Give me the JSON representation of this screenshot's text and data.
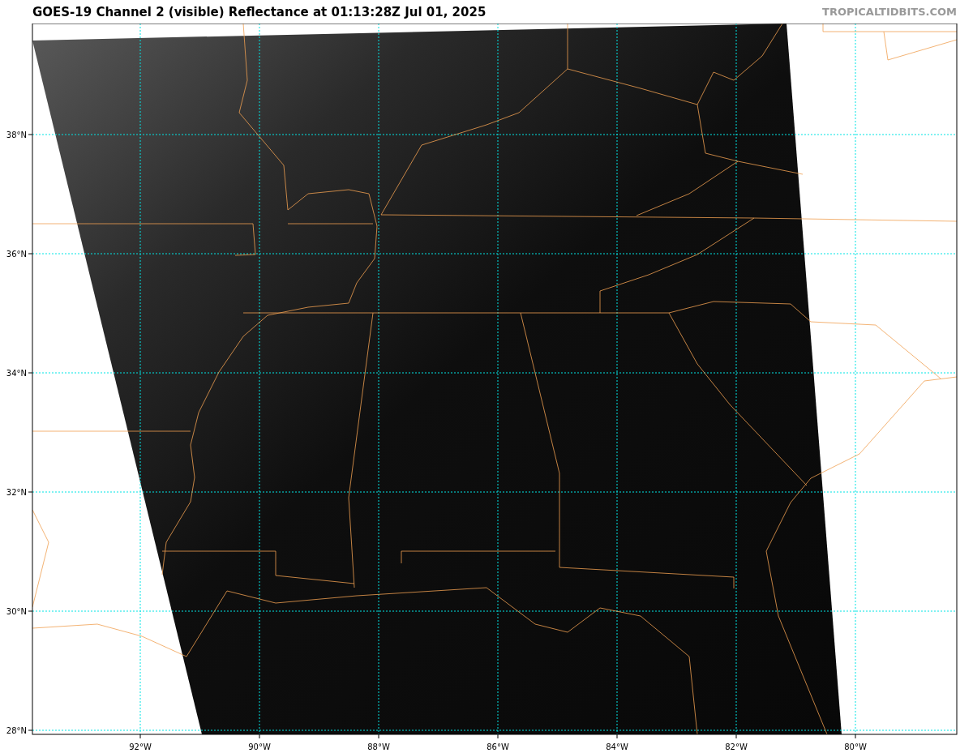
{
  "title": "GOES-19 Channel 2 (visible) Reflectance at 01:13:28Z Jul 01, 2025",
  "credit": "TROPICALTIDBITS.COM",
  "latitude_labels": [
    "38°N",
    "36°N",
    "34°N",
    "32°N",
    "30°N",
    "28°N"
  ],
  "longitude_labels": [
    "92°W",
    "90°W",
    "88°W",
    "86°W",
    "84°W",
    "82°W",
    "80°W"
  ]
}
